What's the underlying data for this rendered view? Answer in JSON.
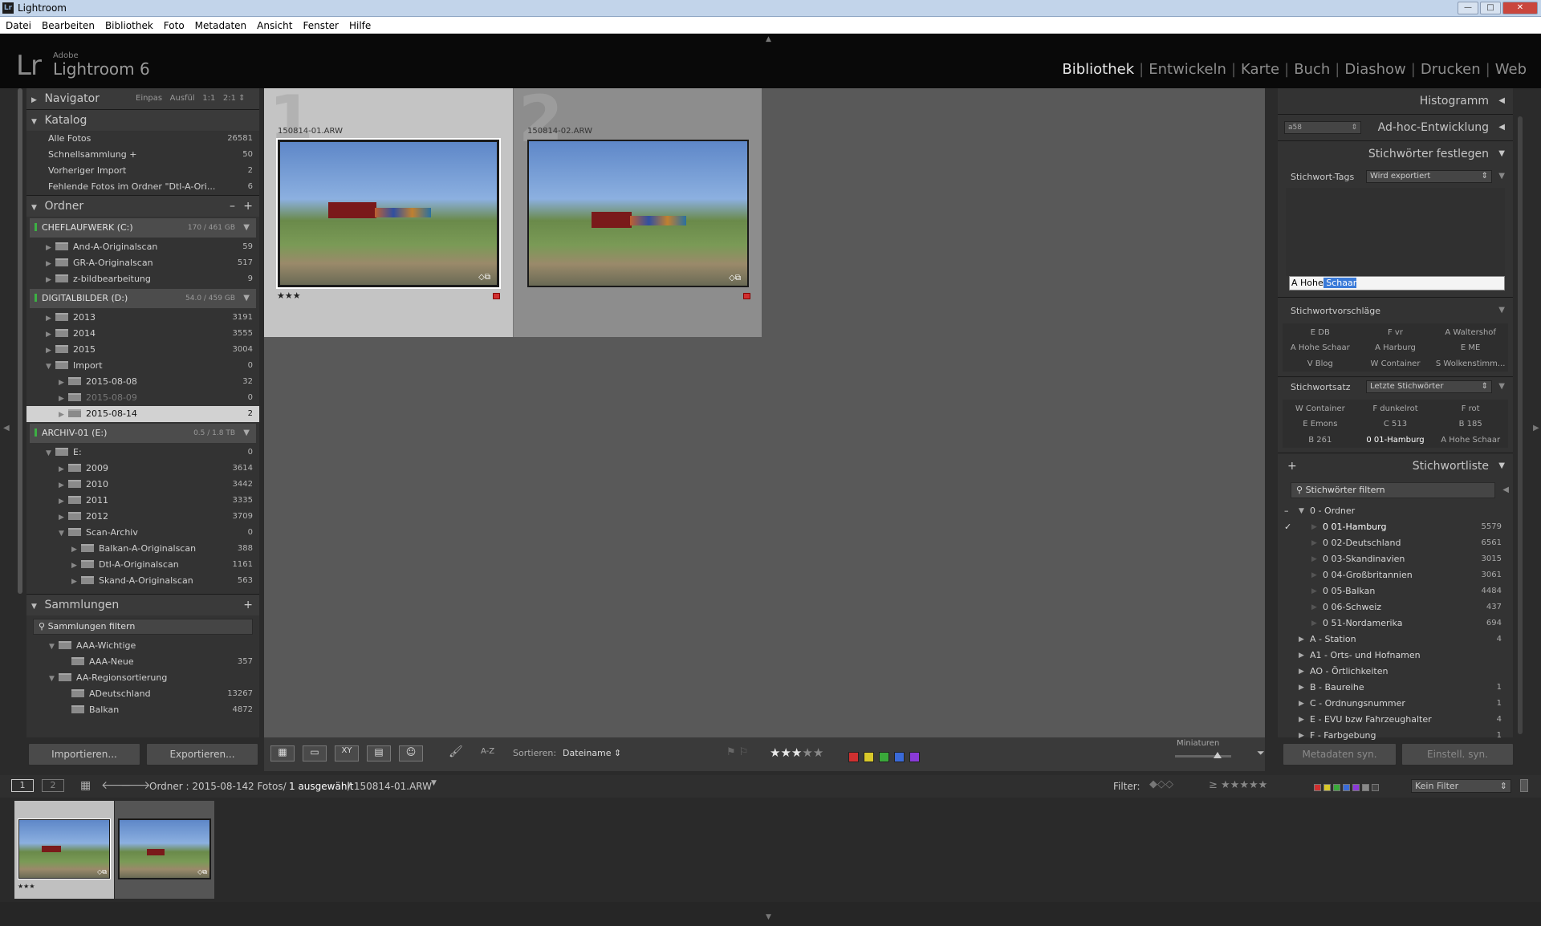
{
  "window": {
    "title": "Lightroom",
    "app_icon": "Lr",
    "controls": [
      "—",
      "□",
      "✕"
    ]
  },
  "menu": [
    "Datei",
    "Bearbeiten",
    "Bibliothek",
    "Foto",
    "Metadaten",
    "Ansicht",
    "Fenster",
    "Hilfe"
  ],
  "header": {
    "logo_lr": "Lr",
    "adobe": "Adobe",
    "product": "Lightroom 6",
    "modules": [
      "Bibliothek",
      "Entwickeln",
      "Karte",
      "Buch",
      "Diashow",
      "Drucken",
      "Web"
    ],
    "active_module": "Bibliothek"
  },
  "navigator": {
    "title": "Navigator",
    "zoom": [
      "Einpas",
      "Ausfül",
      "1:1",
      "2:1"
    ]
  },
  "catalog": {
    "title": "Katalog",
    "items": [
      {
        "label": "Alle Fotos",
        "count": "26581"
      },
      {
        "label": "Schnellsammlung +",
        "count": "50"
      },
      {
        "label": "Vorheriger Import",
        "count": "2"
      },
      {
        "label": "Fehlende Fotos im Ordner \"Dtl-A-Ori...",
        "count": "6"
      }
    ]
  },
  "folders": {
    "title": "Ordner",
    "actions": [
      "–",
      "+"
    ],
    "volumes": [
      {
        "name": "CHEFLAUFWERK (C:)",
        "cap": "170 / 461 GB",
        "items": [
          {
            "label": "And-A-Originalscan",
            "count": "59",
            "depth": 1
          },
          {
            "label": "GR-A-Originalscan",
            "count": "517",
            "depth": 1
          },
          {
            "label": "z-bildbearbeitung",
            "count": "9",
            "depth": 1
          }
        ]
      },
      {
        "name": "DIGITALBILDER (D:)",
        "cap": "54.0 / 459 GB",
        "items": [
          {
            "label": "2013",
            "count": "3191",
            "depth": 1
          },
          {
            "label": "2014",
            "count": "3555",
            "depth": 1
          },
          {
            "label": "2015",
            "count": "3004",
            "depth": 1
          },
          {
            "label": "Import",
            "count": "0",
            "depth": 1,
            "open": true
          },
          {
            "label": "2015-08-08",
            "count": "32",
            "depth": 2
          },
          {
            "label": "2015-08-09",
            "count": "0",
            "depth": 2,
            "dim": true
          },
          {
            "label": "2015-08-14",
            "count": "2",
            "depth": 2,
            "selected": true
          }
        ]
      },
      {
        "name": "ARCHIV-01 (E:)",
        "cap": "0.5 / 1.8 TB",
        "items": [
          {
            "label": "E:",
            "count": "0",
            "depth": 1,
            "open": true
          },
          {
            "label": "2009",
            "count": "3614",
            "depth": 2
          },
          {
            "label": "2010",
            "count": "3442",
            "depth": 2
          },
          {
            "label": "2011",
            "count": "3335",
            "depth": 2
          },
          {
            "label": "2012",
            "count": "3709",
            "depth": 2
          },
          {
            "label": "Scan-Archiv",
            "count": "0",
            "depth": 2,
            "open": true
          },
          {
            "label": "Balkan-A-Originalscan",
            "count": "388",
            "depth": 3
          },
          {
            "label": "Dtl-A-Originalscan",
            "count": "1161",
            "depth": 3
          },
          {
            "label": "Skand-A-Originalscan",
            "count": "563",
            "depth": 3
          }
        ]
      }
    ]
  },
  "collections": {
    "title": "Sammlungen",
    "filter_placeholder": "Sammlungen filtern",
    "items": [
      {
        "label": "AAA-Wichtige",
        "count": "",
        "depth": 1,
        "set": true
      },
      {
        "label": "AAA-Neue",
        "count": "357",
        "depth": 2
      },
      {
        "label": "AA-Regionsortierung",
        "count": "",
        "depth": 1,
        "set": true
      },
      {
        "label": "ADeutschland",
        "count": "13267",
        "depth": 2
      },
      {
        "label": "Balkan",
        "count": "4872",
        "depth": 2
      }
    ]
  },
  "left_buttons": {
    "import": "Importieren...",
    "export": "Exportieren..."
  },
  "grid": {
    "cells": [
      {
        "index": "1",
        "filename": "150814-01.ARW",
        "stars": "★★★",
        "selected": true
      },
      {
        "index": "2",
        "filename": "150814-02.ARW",
        "stars": "",
        "selected": false
      }
    ]
  },
  "right": {
    "histogram": "Histogramm",
    "quick_develop": {
      "preset": "a58",
      "title": "Ad-hoc-Entwicklung"
    },
    "keywording": {
      "title": "Stichwörter festlegen",
      "tags_label": "Stichwort-Tags",
      "tags_mode": "Wird exportiert",
      "input_prefix": "A Hohe",
      "input_selected": " Schaar",
      "suggestions_title": "Stichwortvorschläge",
      "suggestions": [
        "E DB",
        "F vr",
        "A Waltershof",
        "A Hohe Schaar",
        "A Harburg",
        "E ME",
        "V Blog",
        "W Container",
        "S Wolkenstimm..."
      ],
      "set_label": "Stichwortsatz",
      "set_value": "Letzte Stichwörter",
      "set_items": [
        "W Container",
        "F dunkelrot",
        "F rot",
        "E Emons",
        "C 513",
        "B 185",
        "B 261",
        "0 01-Hamburg",
        "A Hohe Schaar"
      ]
    },
    "keyword_list": {
      "title": "Stichwortliste",
      "add": "+",
      "filter_placeholder": "Stichwörter filtern",
      "items": [
        {
          "label": "0 - Ordner",
          "count": "",
          "depth": 0,
          "open": true
        },
        {
          "label": "0 01-Hamburg",
          "count": "5579",
          "depth": 1,
          "checked": true
        },
        {
          "label": "0 02-Deutschland",
          "count": "6561",
          "depth": 1
        },
        {
          "label": "0 03-Skandinavien",
          "count": "3015",
          "depth": 1
        },
        {
          "label": "0 04-Großbritannien",
          "count": "3061",
          "depth": 1
        },
        {
          "label": "0 05-Balkan",
          "count": "4484",
          "depth": 1
        },
        {
          "label": "0 06-Schweiz",
          "count": "437",
          "depth": 1
        },
        {
          "label": "0 51-Nordamerika",
          "count": "694",
          "depth": 1
        },
        {
          "label": "A - Station",
          "count": "4",
          "depth": 0
        },
        {
          "label": "A1 - Orts- und Hofnamen",
          "count": "",
          "depth": 0
        },
        {
          "label": "AO - Örtlichkeiten",
          "count": "",
          "depth": 0
        },
        {
          "label": "B - Baureihe",
          "count": "1",
          "depth": 0
        },
        {
          "label": "C - Ordnungsnummer",
          "count": "1",
          "depth": 0
        },
        {
          "label": "E - EVU bzw Fahrzeughalter",
          "count": "4",
          "depth": 0
        },
        {
          "label": "F - Farbgebung",
          "count": "1",
          "depth": 0
        }
      ]
    },
    "sync_buttons": {
      "metadata": "Metadaten syn.",
      "settings": "Einstell. syn."
    }
  },
  "toolbar": {
    "sort_label": "Sortieren:",
    "sort_value": "Dateiname",
    "sort_icon": "A-Z",
    "rating": [
      "★",
      "★",
      "★",
      "★",
      "★"
    ],
    "rating_value": 3,
    "colors": [
      "#d03030",
      "#d8c82a",
      "#3aa83a",
      "#3a6ad8",
      "#8a3ad8"
    ],
    "thumb_label": "Miniaturen",
    "thumb_size": 0.75
  },
  "filmbar": {
    "screens": [
      "1",
      "2"
    ],
    "source": "Ordner : 2015-08-14",
    "count": "2 Fotos/",
    "selected": "1 ausgewählt",
    "file": "/ 150814-01.ARW",
    "filter_label": "Filter:",
    "filter_value": "Kein Filter",
    "filter_colors": [
      "#d03030",
      "#d8c82a",
      "#3aa83a",
      "#3a6ad8",
      "#8a3ad8",
      "#888",
      "#444"
    ]
  },
  "filmstrip": {
    "stars": "★★★"
  }
}
